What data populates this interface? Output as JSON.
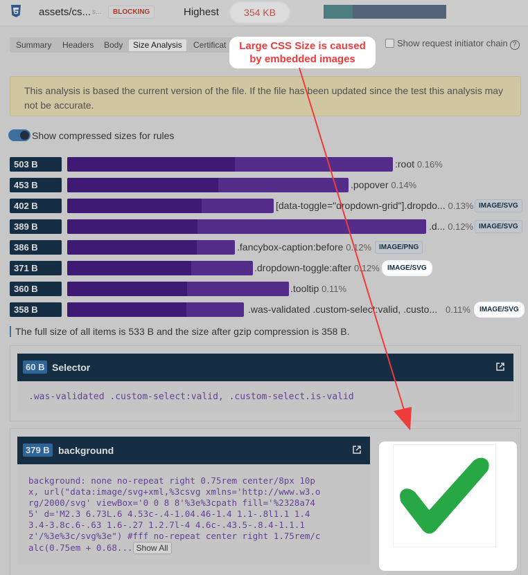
{
  "request": {
    "file_name": "assets/cs...",
    "file_name_suffix": "s...",
    "blocking_label": "BLOCKING",
    "priority": "Highest",
    "size": "354 KB"
  },
  "tabs": [
    {
      "label": "Summary",
      "active": false
    },
    {
      "label": "Headers",
      "active": false
    },
    {
      "label": "Body",
      "active": false
    },
    {
      "label": "Size Analysis",
      "active": true
    },
    {
      "label": "Certificat",
      "active": false
    }
  ],
  "initiator_chain_label": "Show request initiator chain",
  "help_glyph": "?",
  "callout": {
    "line1": "Large CSS Size is caused",
    "line2": "by embedded images"
  },
  "alert_text": "This analysis is based the current version of the file. If the file has been updated since the test this analysis may not be accurate.",
  "compressed_toggle_label": "Show compressed sizes for rules",
  "rules": [
    {
      "size": "503 B",
      "selector": ":root",
      "percent": "0.16%",
      "tag": "",
      "highlight": false,
      "bar_fraction": 0.627,
      "compressed_fraction": 0.323
    },
    {
      "size": "453 B",
      "selector": ".popover",
      "percent": "0.14%",
      "tag": "",
      "highlight": false,
      "bar_fraction": 0.541,
      "compressed_fraction": 0.291
    },
    {
      "size": "402 B",
      "selector": "[data-toggle=\"dropdown-grid\"].dropdo...",
      "percent": "0.13%",
      "tag": "IMAGE/SVG",
      "highlight": false,
      "bar_fraction": 0.397,
      "compressed_fraction": 0.259
    },
    {
      "size": "389 B",
      "selector": ".d...",
      "percent": "0.12%",
      "tag": "IMAGE/SVG",
      "highlight": false,
      "bar_fraction": 0.691,
      "compressed_fraction": 0.25
    },
    {
      "size": "386 B",
      "selector": ".fancybox-caption:before",
      "percent": "0.12%",
      "tag": "IMAGE/PNG",
      "highlight": false,
      "bar_fraction": 0.322,
      "compressed_fraction": 0.249
    },
    {
      "size": "371 B",
      "selector": ".dropdown-toggle:after",
      "percent": "0.12%",
      "tag": "IMAGE/SVG",
      "highlight": true,
      "bar_fraction": 0.357,
      "compressed_fraction": 0.238
    },
    {
      "size": "360 B",
      "selector": ".tooltip",
      "percent": "0.11%",
      "tag": "",
      "highlight": false,
      "bar_fraction": 0.426,
      "compressed_fraction": 0.231
    },
    {
      "size": "358 B",
      "selector": ".was-validated .custom-select:valid, .custo...",
      "percent": "0.11%",
      "tag": "IMAGE/SVG",
      "highlight": true,
      "bar_fraction": 0.34,
      "compressed_fraction": 0.229
    }
  ],
  "summary_text": "The full size of all items is 533 B and the size after gzip compression is 358 B.",
  "selector_card": {
    "size": "60 B",
    "title": "Selector",
    "code": ".was-validated .custom-select:valid, .custom-select.is-valid"
  },
  "background_card": {
    "size": "379 B",
    "title": "background",
    "code_lines": [
      "background: none no-repeat right 0.75rem center/8px 10p",
      "x, url(\"data:image/svg+xml,%3csvg xmlns='http://www.w3.o",
      "rg/2000/svg' viewBox='0 0 8 8'%3e%3cpath fill='%2328a74",
      "5' d='M2.3 6.73L.6 4.53c-.4-1.04.46-1.4 1.1-.8l1.1 1.4",
      "3.4-3.8c.6-.63 1.6-.27 1.2.7l-4 4.6c-.43.5-.8.4-1.1.1",
      "z'/%3e%3c/svg%3e\") #fff no-repeat center right 1.75rem/c",
      "alc(0.75em + 0.68..."
    ],
    "show_all_label": "Show All"
  },
  "colors": {
    "bar_compressed": "#3f1380",
    "bar_full": "#5a2a9b",
    "size_badge": "#0d2b45",
    "callout_text": "#ee3b3b",
    "checkmark": "#28a745"
  }
}
